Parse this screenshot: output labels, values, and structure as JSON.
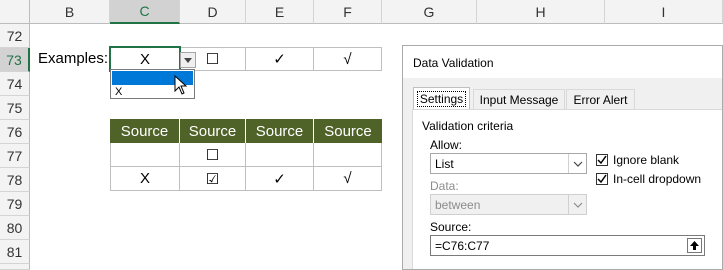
{
  "columns": [
    "B",
    "C",
    "D",
    "E",
    "F",
    "G",
    "H",
    "I"
  ],
  "rows": [
    "72",
    "73",
    "74",
    "75",
    "76",
    "77",
    "78",
    "79",
    "80",
    "81"
  ],
  "examples_label": "Examples:",
  "examples_row": {
    "c": "X",
    "d": "☐",
    "e": "✓",
    "f": "√"
  },
  "dropdown": {
    "items": [
      "",
      "X"
    ]
  },
  "source_table": {
    "headers": [
      "Source",
      "Source",
      "Source",
      "Source"
    ],
    "rows": [
      [
        "",
        "☐",
        "",
        ""
      ],
      [
        "X",
        "☑",
        "✓",
        "√"
      ]
    ]
  },
  "dialog": {
    "title": "Data Validation",
    "tabs": [
      "Settings",
      "Input Message",
      "Error Alert"
    ],
    "active_tab": "Settings",
    "section": "Validation criteria",
    "allow_label": "Allow:",
    "allow_value": "List",
    "data_label": "Data:",
    "data_value": "between",
    "ignore_blank": "Ignore blank",
    "ignore_blank_checked": true,
    "incell_dropdown": "In-cell dropdown",
    "incell_dropdown_checked": true,
    "source_label": "Source:",
    "source_value": "=C76:C77"
  },
  "colors": {
    "header_green": "#4f6228",
    "excel_green": "#217346",
    "highlight_blue": "#0078d7"
  }
}
